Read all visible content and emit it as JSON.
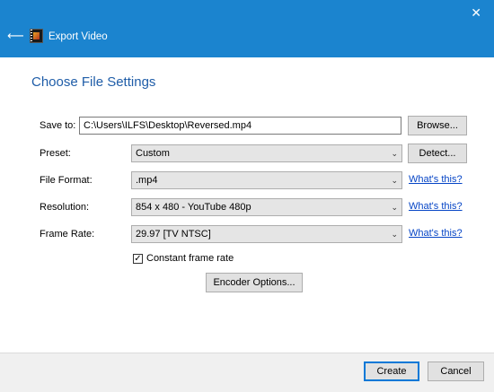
{
  "window": {
    "title": "Export Video",
    "back_icon": "back-arrow-icon",
    "app_icon": "film-strip-icon",
    "close_icon": "close-icon",
    "back_glyph": "⟵",
    "close_glyph": "✕",
    "titlebar_color": "#1b84cf"
  },
  "heading": "Choose File Settings",
  "save_to": {
    "label": "Save to:",
    "value": "C:\\Users\\ILFS\\Desktop\\Reversed.mp4",
    "browse_label": "Browse..."
  },
  "preset": {
    "label": "Preset:",
    "value": "Custom",
    "detect_label": "Detect..."
  },
  "file_format": {
    "label": "File Format:",
    "value": ".mp4",
    "help_link": "What's this?"
  },
  "resolution": {
    "label": "Resolution:",
    "value": "854 x 480 - YouTube 480p",
    "help_link": "What's this?"
  },
  "frame_rate": {
    "label": "Frame Rate:",
    "value": "29.97 [TV NTSC]",
    "help_link": "What's this?"
  },
  "constant_frame_rate": {
    "label": "Constant frame rate",
    "checked": true,
    "check_glyph": "✓"
  },
  "encoder_options_label": "Encoder Options...",
  "footer": {
    "create_label": "Create",
    "cancel_label": "Cancel"
  },
  "dropdown_glyph": "⌄"
}
